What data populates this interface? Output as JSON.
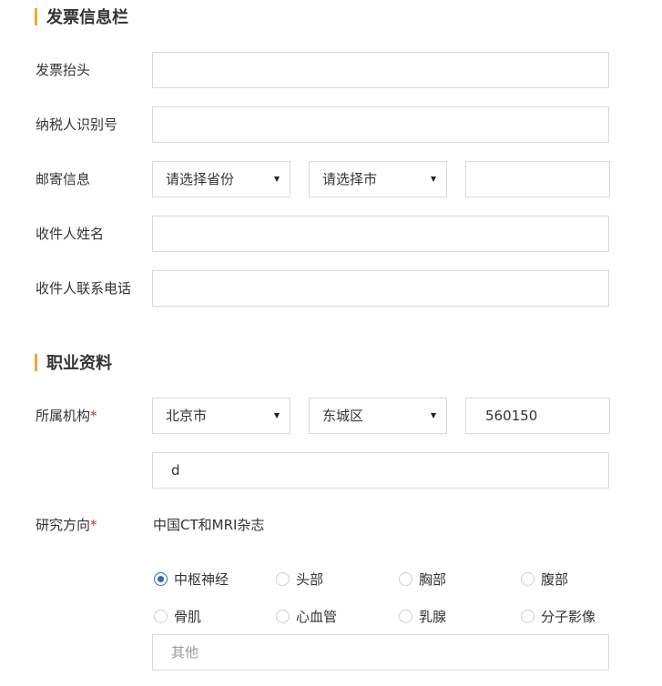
{
  "colors": {
    "accent_bar": "#f0a830",
    "required_mark": "#e02020",
    "radio_checked": "#2c6fae"
  },
  "invoice_section": {
    "title": "发票信息栏",
    "invoice_title_label": "发票抬头",
    "invoice_title_value": "",
    "taxpayer_id_label": "纳税人识别号",
    "taxpayer_id_value": "",
    "mailing_label": "邮寄信息",
    "province_select": "请选择省份",
    "city_select": "请选择市",
    "mailing_address_value": "",
    "recipient_name_label": "收件人姓名",
    "recipient_name_value": "",
    "recipient_phone_label": "收件人联系电话",
    "recipient_phone_value": ""
  },
  "career_section": {
    "title": "职业资料",
    "institution_label": "所属机构",
    "required_mark": "*",
    "province_select": "北京市",
    "district_select": "东城区",
    "postal_code_value": "560150",
    "institution_name_value": "d",
    "research_label": "研究方向",
    "journal_name": "中国CT和MRI杂志",
    "research_options": [
      {
        "label": "中枢神经",
        "checked": true
      },
      {
        "label": "头部",
        "checked": false
      },
      {
        "label": "胸部",
        "checked": false
      },
      {
        "label": "腹部",
        "checked": false
      },
      {
        "label": "骨肌",
        "checked": false
      },
      {
        "label": "心血管",
        "checked": false
      },
      {
        "label": "乳腺",
        "checked": false
      },
      {
        "label": "分子影像",
        "checked": false
      }
    ],
    "other_placeholder": "其他"
  }
}
